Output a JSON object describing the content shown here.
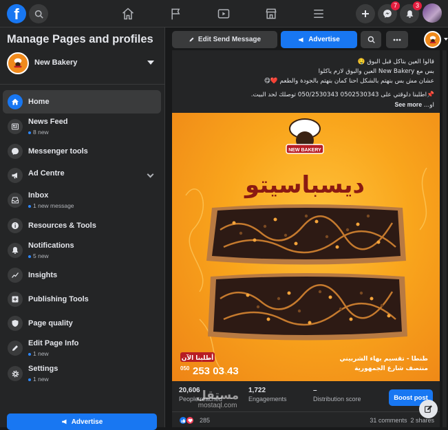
{
  "topbar": {
    "logo": "f",
    "icons": [
      "search-icon",
      "home-icon",
      "flag-icon",
      "video-icon",
      "marketplace-icon",
      "menu-icon",
      "plus-icon",
      "messenger-icon",
      "bell-icon"
    ],
    "messenger_badge": "7",
    "notifications_badge": "3"
  },
  "sidebar": {
    "title": "Manage Pages and profiles",
    "page_name": "New Bakery",
    "items": [
      {
        "label": "Home",
        "sub": "",
        "icon": "home-icon",
        "active": true
      },
      {
        "label": "News Feed",
        "sub": "8 new",
        "icon": "news-feed-icon"
      },
      {
        "label": "Messenger tools",
        "sub": "",
        "icon": "messenger-icon"
      },
      {
        "label": "Ad Centre",
        "sub": "",
        "icon": "megaphone-icon",
        "expandable": true
      },
      {
        "label": "Inbox",
        "sub": "1 new message",
        "icon": "inbox-icon"
      },
      {
        "label": "Resources & Tools",
        "sub": "",
        "icon": "info-icon"
      },
      {
        "label": "Notifications",
        "sub": "5 new",
        "icon": "bell-icon"
      },
      {
        "label": "Insights",
        "sub": "",
        "icon": "insights-icon"
      },
      {
        "label": "Publishing Tools",
        "sub": "",
        "icon": "publishing-icon"
      },
      {
        "label": "Page quality",
        "sub": "",
        "icon": "shield-icon"
      },
      {
        "label": "Edit Page Info",
        "sub": "1 new",
        "icon": "pencil-icon"
      },
      {
        "label": "Settings",
        "sub": "1 new",
        "icon": "gear-icon"
      }
    ],
    "advertise_label": "Advertise"
  },
  "toolbar": {
    "edit_send_message": "Edit Send Message",
    "advertise": "Advertise"
  },
  "post": {
    "text_lines": [
      "قالوا العين بتاكل قبل البوق 🤤",
      "بس مع New Bakery العين والبوق لازم ياكلوا",
      "عشان مش بس بنهتم بالشكل احنا كمان بنهتم بالجودة والطعم ❤️😋",
      "",
      "📌اطلبنا دلوقتي على 0502530343 050/2530343 توصلك لحد البيت.",
      "او..."
    ],
    "see_more": "See more",
    "image": {
      "brand": "NEW BAKERY",
      "product_name": "ديسباسيتو",
      "order_now": "أطلبنا الآن",
      "phone_prefix": "050",
      "phone": "253 03 43",
      "branch_line1": "طنطا - تقسيم بهاء الشربيني",
      "branch_line2": "منتصف شارع الجمهورية"
    },
    "stats": [
      {
        "value": "20,606",
        "label": "People reached"
      },
      {
        "value": "1,722",
        "label": "Engagements"
      },
      {
        "value": "–",
        "label": "Distribution score"
      }
    ],
    "boost_label": "Boost post",
    "reaction_count": "285",
    "comments": "31 comments",
    "shares": "2 shares"
  },
  "watermark": {
    "arabic": "مستقل",
    "latin": "mostaql.com"
  },
  "colors": {
    "accent": "#1877f2",
    "background": "#18191a",
    "surface": "#242526",
    "badge": "#e41e3f"
  }
}
